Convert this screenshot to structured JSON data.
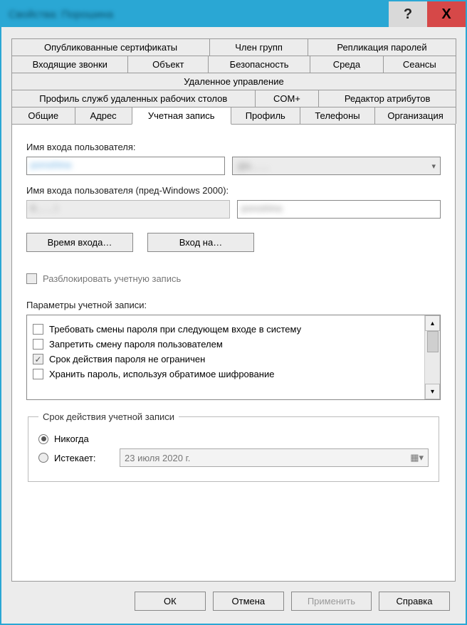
{
  "titlebar": {
    "title": "Свойства: Порошина",
    "help_symbol": "?",
    "close_symbol": "X"
  },
  "tabs": {
    "row1": [
      "Опубликованные сертификаты",
      "Член групп",
      "Репликация паролей"
    ],
    "row2": [
      "Входящие звонки",
      "Объект",
      "Безопасность",
      "Среда",
      "Сеансы"
    ],
    "row3": [
      "Удаленное управление"
    ],
    "row4": [
      "Профиль служб удаленных рабочих столов",
      "COM+",
      "Редактор атрибутов"
    ],
    "row5": [
      "Общие",
      "Адрес",
      "Учетная запись",
      "Профиль",
      "Телефоны",
      "Организация"
    ],
    "active": "Учетная запись"
  },
  "account": {
    "logon_label": "Имя входа пользователя:",
    "logon_value": "poroshina",
    "domain_value": "@k……",
    "prewin_label": "Имя входа пользователя (пред-Windows 2000):",
    "prewin_domain": "K……\\",
    "prewin_value": "poroshina",
    "logon_hours_btn": "Время входа…",
    "logon_to_btn": "Вход на…",
    "unlock_label": "Разблокировать учетную запись",
    "options_label": "Параметры учетной записи:",
    "options": [
      {
        "label": "Требовать смены пароля при следующем входе в систему",
        "checked": false
      },
      {
        "label": "Запретить смену пароля пользователем",
        "checked": false
      },
      {
        "label": "Срок действия пароля не ограничен",
        "checked": true
      },
      {
        "label": "Хранить пароль, используя обратимое шифрование",
        "checked": false
      }
    ],
    "expiry_legend": "Срок действия учетной записи",
    "never_label": "Никогда",
    "expires_label": "Истекает:",
    "expires_date": "23   июля   2020 г."
  },
  "buttons": {
    "ok": "ОК",
    "cancel": "Отмена",
    "apply": "Применить",
    "help": "Справка"
  }
}
